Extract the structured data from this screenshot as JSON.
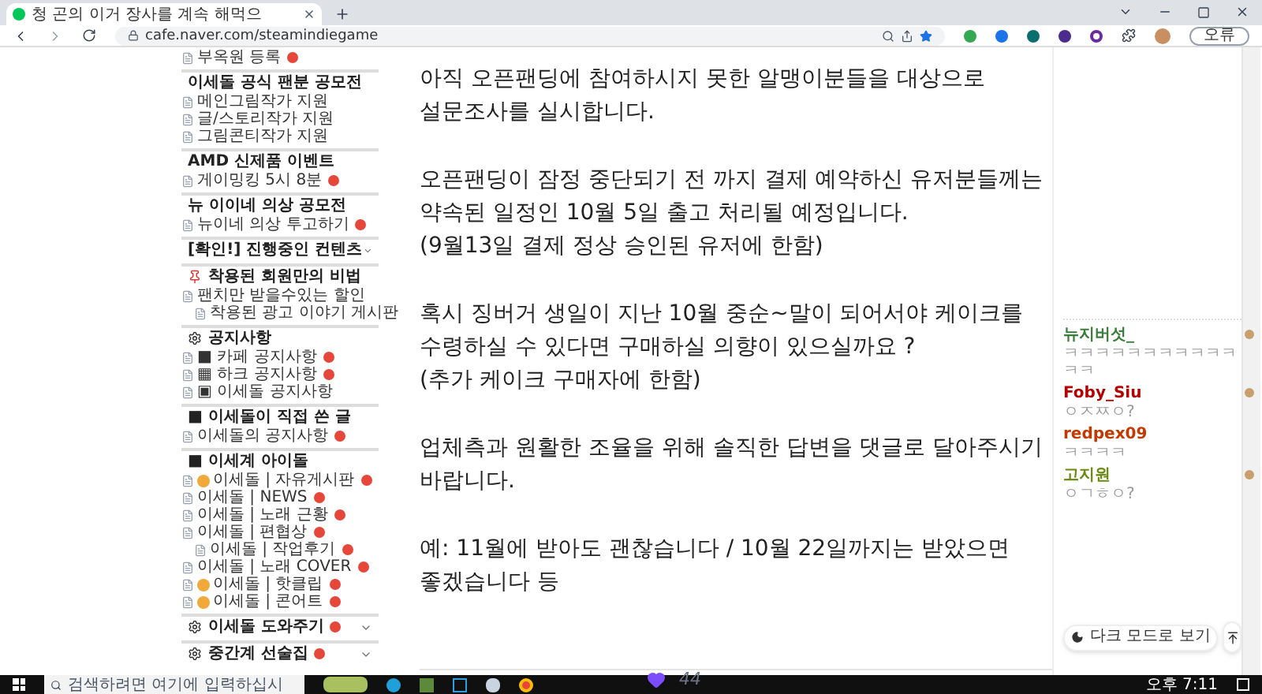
{
  "browser": {
    "tab_title": "청 곤의 이거 장사를 계속 해먹으",
    "address": "cafe.naver.com/steamindiegame",
    "profile_label": "오류"
  },
  "sidebar": [
    {
      "kind": "item",
      "label": "부옥원 등록",
      "new": true
    },
    {
      "kind": "header",
      "label": "이세돌 공식 팬분 공모전"
    },
    {
      "kind": "item",
      "label": "메인그림작가 지원",
      "new": false
    },
    {
      "kind": "item",
      "label": "글/스토리작가 지원",
      "new": false
    },
    {
      "kind": "item",
      "label": "그림콘티작가 지원",
      "new": false
    },
    {
      "kind": "header",
      "label": "AMD 신제품 이벤트"
    },
    {
      "kind": "item",
      "label": "게이밍킹 5시 8분",
      "new": true
    },
    {
      "kind": "header",
      "label": "뉴 이이네 의상 공모전"
    },
    {
      "kind": "item",
      "label": "뉴이네 의상 투고하기",
      "new": true
    },
    {
      "kind": "header",
      "label": "[확인!] 진행중인 컨텐츠",
      "caret": true
    },
    {
      "kind": "pin_header",
      "label": "착용된 회원만의 비법"
    },
    {
      "kind": "item",
      "label": "팬치만 받을수있는 할인",
      "new": false,
      "children": [
        {
          "kind": "item",
          "label": "착용된 광고 이야기 게시판",
          "new": false
        }
      ]
    },
    {
      "kind": "gear_header",
      "label": "공지사항"
    },
    {
      "kind": "item",
      "label": "■ 카페 공지사항",
      "new": true
    },
    {
      "kind": "item",
      "label": "▦ 하크 공지사항",
      "new": true
    },
    {
      "kind": "item",
      "label": "▣ 이세돌 공지사항",
      "new": false
    },
    {
      "kind": "header",
      "label": "■ 이세돌이 직접 쓴 글"
    },
    {
      "kind": "item",
      "label": "이세돌의 공지사항",
      "new": true
    },
    {
      "kind": "header",
      "label": "■ 이세계 아이돌"
    },
    {
      "kind": "item",
      "label": "이세돌 | 자유게시판",
      "new": true,
      "emoji": true
    },
    {
      "kind": "item",
      "label": "이세돌 | NEWS",
      "new": true
    },
    {
      "kind": "item",
      "label": "이세돌 | 노래 근황",
      "new": true
    },
    {
      "kind": "item",
      "label": "이세돌 | 편협상",
      "new": true,
      "children": [
        {
          "kind": "item",
          "label": "이세돌 | 작업후기",
          "new": true
        }
      ]
    },
    {
      "kind": "item",
      "label": "이세돌 | 노래 COVER",
      "new": true
    },
    {
      "kind": "item",
      "label": "이세돌 | 핫클립",
      "new": true,
      "emoji": true
    },
    {
      "kind": "item",
      "label": "이세돌 | 콘어트",
      "new": true,
      "emoji": true
    },
    {
      "kind": "gear_header",
      "label": "이세돌 도와주기",
      "new": true,
      "caret": true
    },
    {
      "kind": "gear_header",
      "label": "중간계 선술집",
      "new": true,
      "caret": true
    }
  ],
  "post": {
    "paragraphs": [
      [
        "아직 오픈팬딩에 참여하시지 못한 알맹이분들을 대상으로",
        "설문조사를 실시합니다."
      ],
      [
        "오픈팬딩이 잠정 중단되기 전 까지 결제 예약하신 유저분들께는",
        "약속된 일정인 10월 5일 출고 처리될 예정입니다.",
        "(9월13일 결제 정상 승인된 유저에 한함)"
      ],
      [
        "혹시 징버거 생일이 지난 10월 중순~말이 되어서야 케이크를",
        "수령하실 수 있다면 구매하실 의향이 있으실까요 ?",
        "(추가 케이크 구매자에 한함)"
      ],
      [
        "업체측과 원활한 조율을 위해 솔직한 답변을 댓글로 달아주시기",
        "바랍니다."
      ],
      [
        "예: 11월에 받아도 괜찮습니다 / 10월 22일까지는 받았으면",
        "좋겠습니다 등"
      ]
    ],
    "like_count": "44"
  },
  "comments": [
    {
      "name": "뉴지버섯_",
      "color": "#3b7d3b",
      "text": "ㅋㅋㅋㅋㅋㅋㅋㅋㅋㅋㅋㅋㅋ",
      "avatar": true
    },
    {
      "name": "Foby_Siu",
      "color": "#b40000",
      "text": "ㅇㅈㅉㅇ?",
      "avatar": true
    },
    {
      "name": "redpex09",
      "color": "#c23a00",
      "text": "ㅋㅋㅋㅋ",
      "avatar": false
    },
    {
      "name": "고지원",
      "color": "#6b8a12",
      "text": "ㅇㄱㅎㅇ?",
      "avatar": true
    }
  ],
  "dark_mode_button": "다크 모드로 보기",
  "taskbar": {
    "search_placeholder": "검색하려면 여기에 입력하십시",
    "time": "오후 7:11"
  }
}
